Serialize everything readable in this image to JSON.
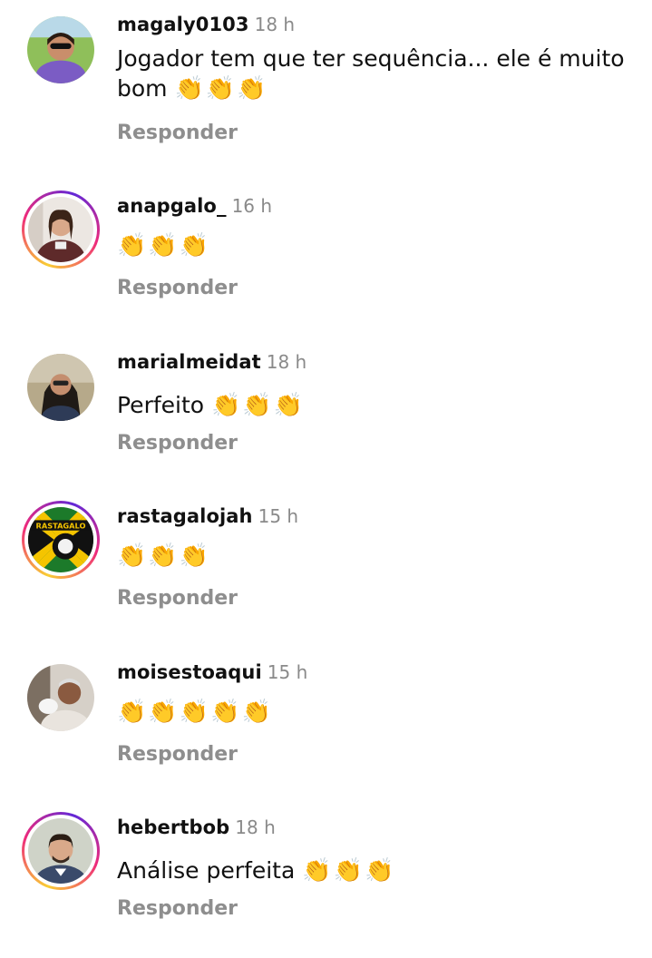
{
  "comments": [
    {
      "username": "magaly0103",
      "time": "18 h",
      "text": "Jogador tem que ter sequência... ele é muito bom",
      "emojis": "👏👏👏",
      "reply": "Responder"
    },
    {
      "username": "anapgalo_",
      "time": "16 h",
      "text": "",
      "emojis": "👏👏👏",
      "reply": "Responder"
    },
    {
      "username": "marialmeidat",
      "time": "18 h",
      "text": "Perfeito",
      "emojis": "👏👏👏",
      "reply": "Responder"
    },
    {
      "username": "rastagalojah",
      "time": "15 h",
      "text": "",
      "emojis": "👏👏👏",
      "reply": "Responder",
      "avatar_text": "RASTAGALO"
    },
    {
      "username": "moisestoaqui",
      "time": "15 h",
      "text": "",
      "emojis": "👏👏👏👏👏",
      "reply": "Responder"
    },
    {
      "username": "hebertbob",
      "time": "18 h",
      "text": "Análise perfeita",
      "emojis": "👏👏👏",
      "reply": "Responder"
    }
  ],
  "colors": {
    "username": "#111111",
    "time": "#8a8a8a",
    "reply": "#8e8e8e",
    "emoji": "#e9a51c",
    "emoji_light": "#d9b58a"
  }
}
